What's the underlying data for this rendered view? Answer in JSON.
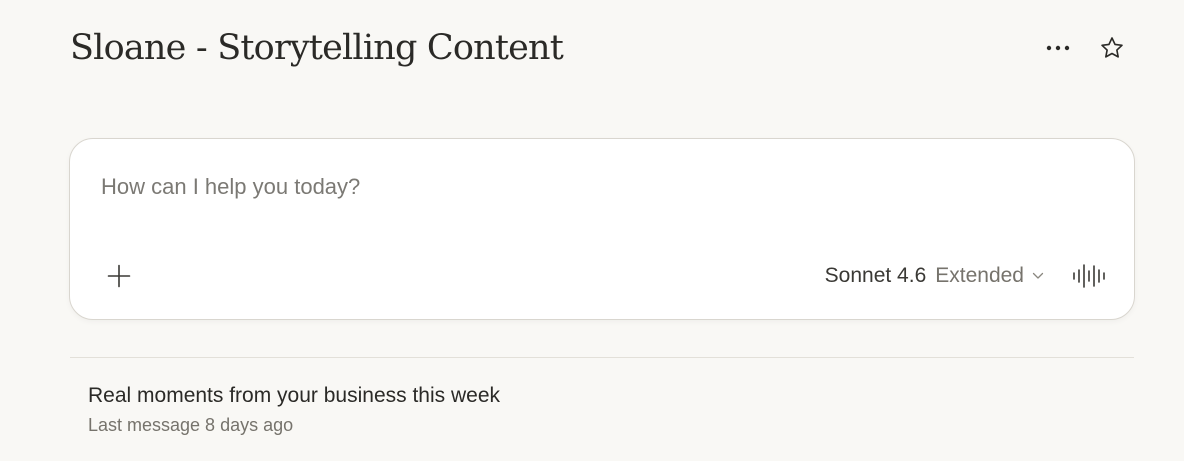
{
  "project": {
    "title": "Sloane - Storytelling Content"
  },
  "header": {
    "icons": [
      "more-options-icon",
      "star-icon"
    ]
  },
  "composer": {
    "placeholder": "How can I help you today?",
    "value": "",
    "attach_icon": "plus-icon",
    "model_name": "Sonnet 4.6",
    "model_mode": "Extended",
    "dropdown_icon": "chevron-down-icon",
    "voice_icon": "voice-waveform-icon"
  },
  "chats": [
    {
      "title": "Real moments from your business this week",
      "meta": "Last message 8 days ago"
    }
  ],
  "colors": {
    "background": "#f9f8f5",
    "card": "#ffffff",
    "text": "#2b2a27",
    "muted": "#76736c",
    "border": "#d9d6cf"
  }
}
